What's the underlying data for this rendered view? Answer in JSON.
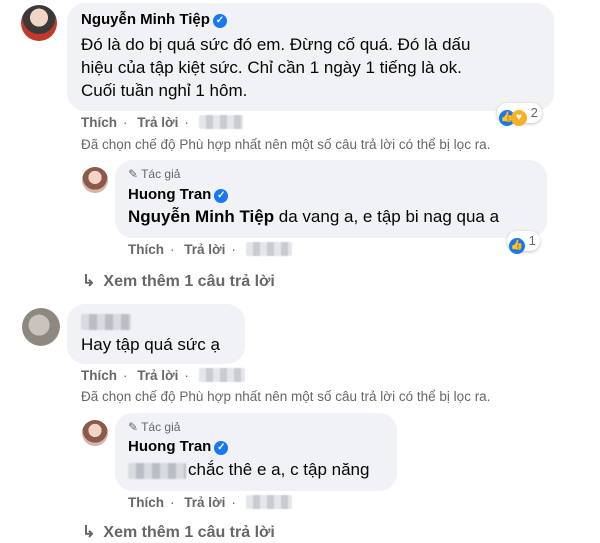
{
  "comments": [
    {
      "author": "Nguyễn Minh Tiệp",
      "lines": [
        "Đó là do bị quá sức đó em. Đừng cố quá. Đó là dấu",
        "hiệu của tập kiệt sức. Chỉ cần 1 ngày 1 tiếng là ok.",
        "Cuối tuần nghỉ 1 hôm."
      ],
      "reaction_count": "2",
      "like_label": "Thích",
      "reply_label": "Trả lời",
      "filter_note": "Đã chọn chế độ Phù hợp nhất nên một số câu trả lời có thể bị lọc ra."
    },
    {
      "badge": "Tác giả",
      "author": "Huong Tran",
      "mention": "Nguyễn Minh Tiệp",
      "text": " da vang a, e tập bi nag qua a",
      "reaction_count": "1",
      "like_label": "Thích",
      "reply_label": "Trả lời",
      "more_label": "Xem thêm 1 câu trả lời"
    },
    {
      "text": "Hay tập quá sức ạ",
      "like_label": "Thích",
      "reply_label": "Trả lời",
      "filter_note": "Đã chọn chế độ Phù hợp nhất nên một số câu trả lời có thể bị lọc ra."
    },
    {
      "badge": "Tác giả",
      "author": "Huong Tran",
      "text": "chắc thê e a, c tập năng",
      "like_label": "Thích",
      "reply_label": "Trả lời",
      "more_label": "Xem thêm 1 câu trả lời"
    }
  ],
  "colors": {
    "bubble": "#f0f2f5",
    "meta": "#65676b",
    "verified": "#1877f2"
  },
  "icons": {
    "verified": "verified-badge-icon",
    "like": "like-reaction-icon",
    "care": "care-reaction-icon",
    "reply_arrow": "reply-arrow-icon",
    "author": "pen-icon"
  }
}
